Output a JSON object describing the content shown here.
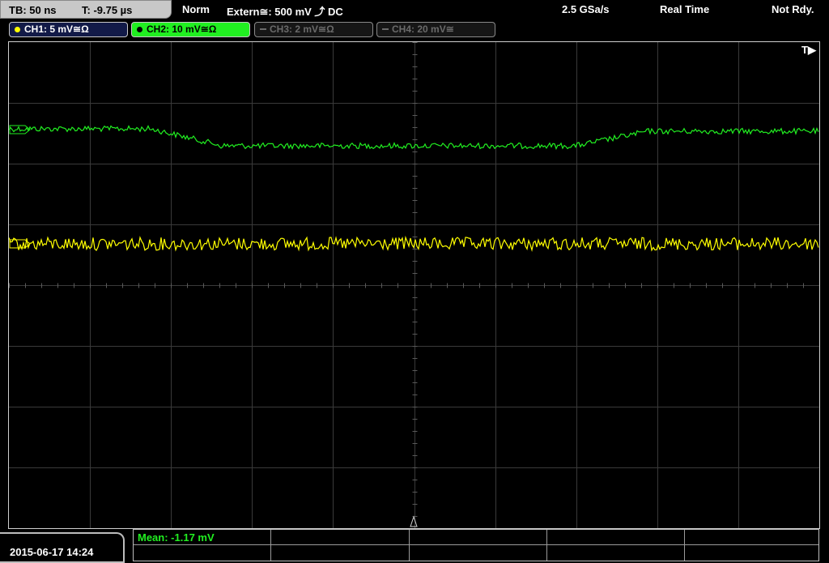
{
  "header": {
    "timebase": "TB: 50 ns",
    "trigger_time": "T: -9.75 µs",
    "mode": "Norm",
    "trigger_source": "Extern≅: 500 mV ⤴ DC",
    "sample_rate": "2.5 GSa/s",
    "acquisition": "Real Time",
    "status": "Not Rdy."
  },
  "channels": [
    {
      "label": "CH1: 5 mV≅Ω",
      "color": "#ffff00",
      "active": true
    },
    {
      "label": "CH2: 10 mV≅Ω",
      "color": "#21ef21",
      "active": true,
      "selected": true
    },
    {
      "label": "CH3: 2 mV≅Ω",
      "color": "#6a6a6a",
      "active": false
    },
    {
      "label": "CH4: 20 mV≅",
      "color": "#6a6a6a",
      "active": false
    }
  ],
  "screen": {
    "trigger_marker": "T▶",
    "ch1_marker": "CH1",
    "ch2_marker": "CH2"
  },
  "footer": {
    "datetime": "2015-06-17 14:24",
    "measurement": "Mean: -1.17 mV"
  },
  "colors": {
    "ch1": "#ffff00",
    "ch2": "#21ef21",
    "grid": "#3a3a3a"
  }
}
